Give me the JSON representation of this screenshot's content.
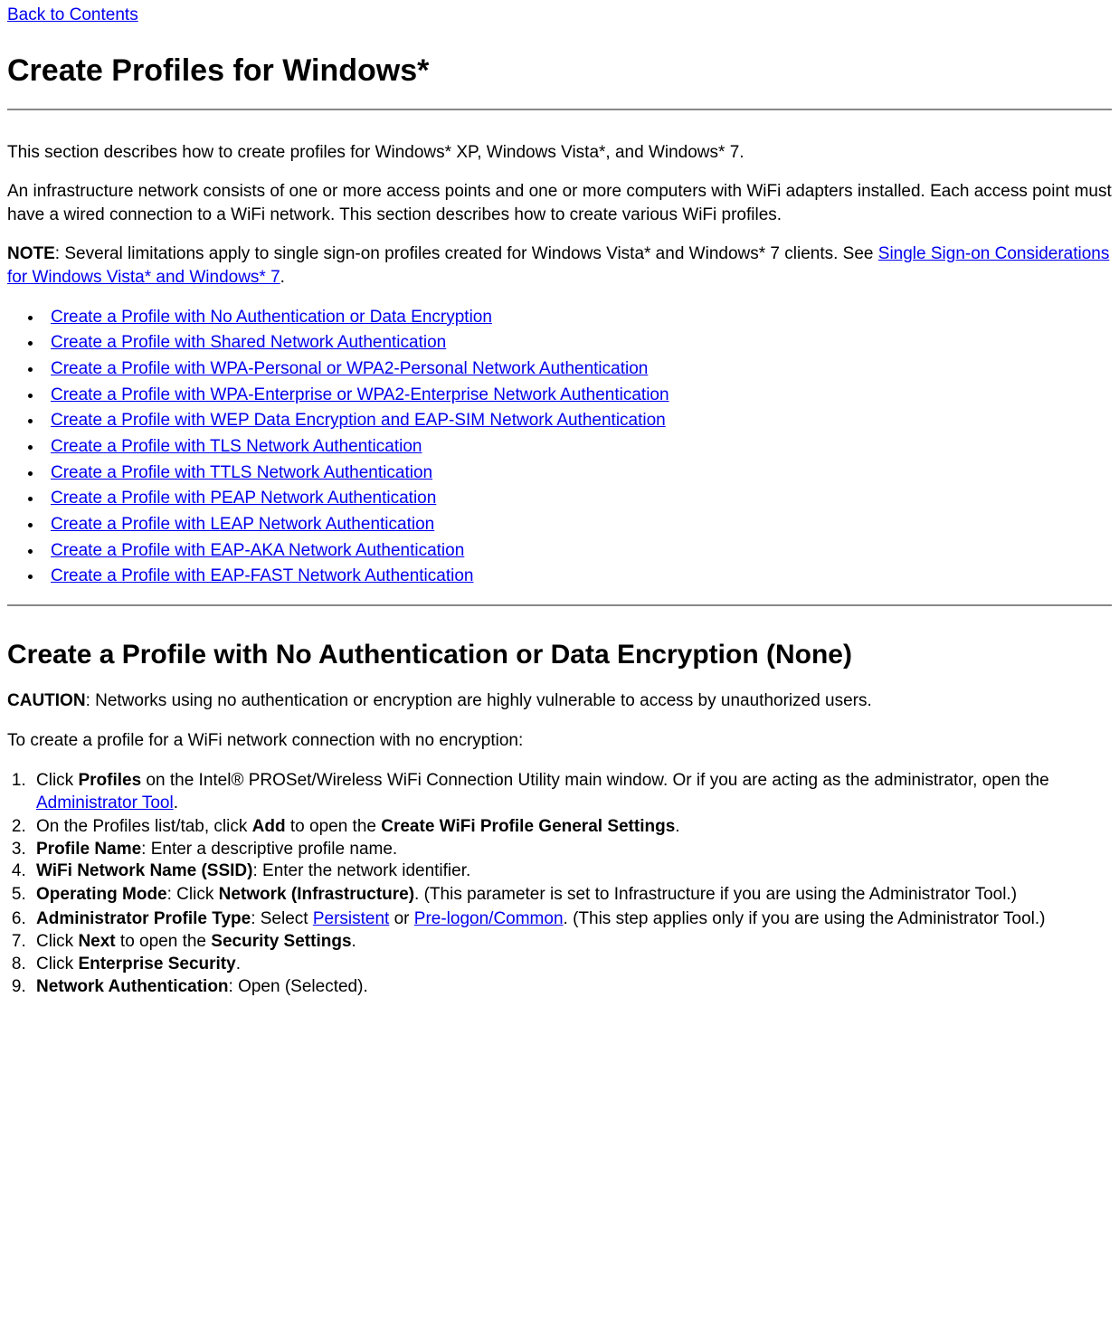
{
  "topLink": "Back to Contents",
  "title": "Create Profiles for Windows*",
  "intro1": "This section describes how to create profiles for Windows* XP, Windows Vista*, and Windows* 7.",
  "intro2": "An infrastructure network consists of one or more access points and one or more computers with WiFi adapters installed. Each access point must have a wired connection to a WiFi network. This section describes how to create various WiFi profiles.",
  "noteLabel": "NOTE",
  "noteBody1": ": Several limitations apply to single sign-on profiles created for Windows Vista* and Windows* 7 clients. See ",
  "noteLink": "Single Sign-on Considerations for Windows Vista* and Windows* 7",
  "noteBody2": ".",
  "links": [
    "Create a Profile with No Authentication or Data Encryption",
    "Create a Profile with Shared Network Authentication",
    "Create a Profile with WPA-Personal or WPA2-Personal Network Authentication",
    "Create a Profile with WPA-Enterprise or WPA2-Enterprise Network Authentication",
    "Create a Profile with WEP Data Encryption and EAP-SIM Network Authentication",
    "Create a Profile with TLS Network Authentication",
    "Create a Profile with TTLS Network Authentication",
    "Create a Profile with PEAP Network Authentication",
    "Create a Profile with LEAP Network Authentication",
    "Create a Profile with EAP-AKA Network Authentication",
    "Create a Profile with EAP-FAST Network Authentication"
  ],
  "section2Title": "Create a Profile with No Authentication or Data Encryption (None)",
  "cautionLabel": "CAUTION",
  "cautionBody": ": Networks using no authentication or encryption are highly vulnerable to access by unauthorized users.",
  "stepsIntro": "To create a profile for a WiFi network connection with no encryption:",
  "steps": {
    "s1a": "Click ",
    "s1b": "Profiles",
    "s1c": " on the Intel® PROSet/Wireless WiFi Connection Utility main window. Or if you are acting as the administrator, open the ",
    "s1link": "Administrator Tool",
    "s1d": ".",
    "s2a": "On the Profiles list/tab, click ",
    "s2b": "Add",
    "s2c": " to open the ",
    "s2d": "Create WiFi Profile General Settings",
    "s2e": ".",
    "s3a": "Profile Name",
    "s3b": ": Enter a descriptive profile name.",
    "s4a": "WiFi Network Name (SSID)",
    "s4b": ": Enter the network identifier.",
    "s5a": "Operating Mode",
    "s5b": ": Click ",
    "s5c": "Network (Infrastructure)",
    "s5d": ". (This parameter is set to Infrastructure if you are using the Administrator Tool.)",
    "s6a": "Administrator Profile Type",
    "s6b": ": Select ",
    "s6link1": "Persistent",
    "s6c": " or ",
    "s6link2": "Pre-logon/Common",
    "s6d": ". (This step applies only if you are using the Administrator Tool.)",
    "s7a": "Click ",
    "s7b": "Next",
    "s7c": " to open the ",
    "s7d": "Security Settings",
    "s7e": ".",
    "s8a": "Click ",
    "s8b": "Enterprise Security",
    "s8c": ".",
    "s9a": "Network Authentication",
    "s9b": ": Open (Selected)."
  }
}
